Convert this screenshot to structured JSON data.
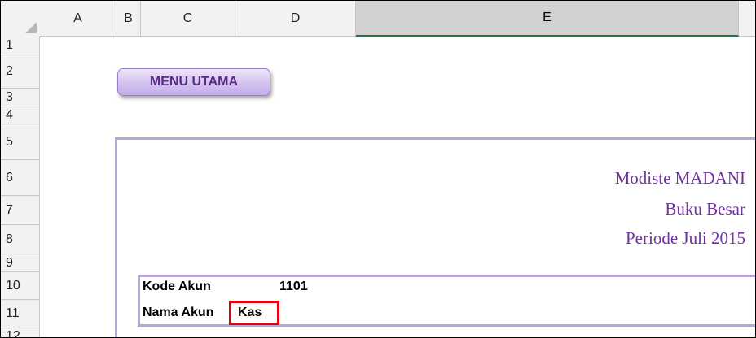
{
  "sheet": {
    "columns": [
      {
        "label": "A"
      },
      {
        "label": "B"
      },
      {
        "label": "C"
      },
      {
        "label": "D"
      },
      {
        "label": "E",
        "selected": true
      }
    ],
    "rows": [
      "1",
      "2",
      "3",
      "4",
      "5",
      "6",
      "7",
      "8",
      "9",
      "10",
      "11",
      "12"
    ]
  },
  "menu_button": {
    "label": "MENU UTAMA"
  },
  "report": {
    "company": "Modiste MADANI",
    "title": "Buku Besar",
    "period": "Periode Juli 2015"
  },
  "account": {
    "code_label": "Kode Akun",
    "code_value": "1101",
    "name_label": "Nama Akun",
    "name_value": "Kas"
  },
  "colors": {
    "title_text": "#7030a0",
    "border_purple": "#b7a5d8",
    "highlight_red": "#e6000e",
    "selected_header_underline": "#217346"
  }
}
